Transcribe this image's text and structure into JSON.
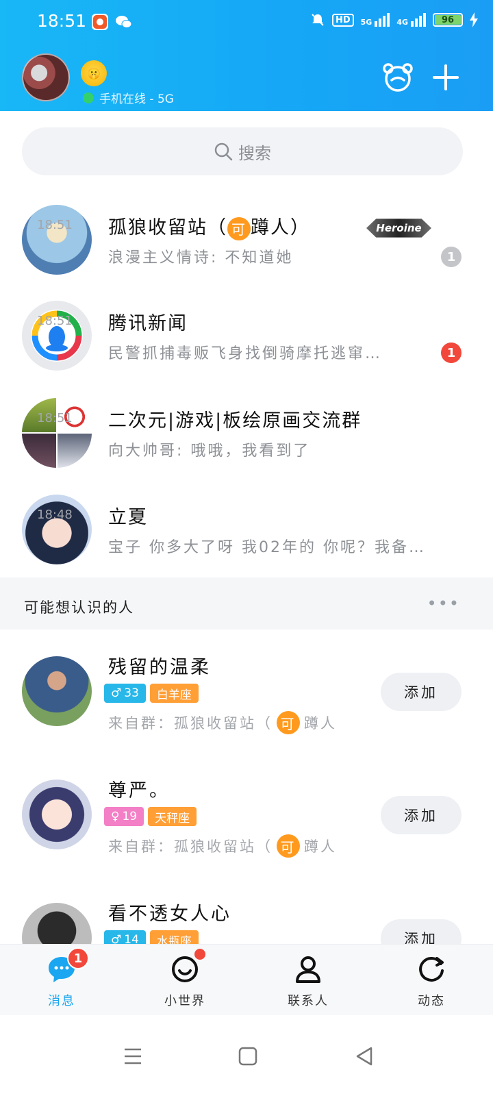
{
  "status_bar": {
    "time": "18:51",
    "network_left": "5G",
    "network_right": "4G",
    "hd": "HD",
    "battery": "96"
  },
  "profile": {
    "status_text": "手机在线 - 5G"
  },
  "search": {
    "placeholder": "搜索"
  },
  "chats": [
    {
      "name_prefix": "孤狼收留站（",
      "name_badge": "可",
      "name_suffix": "蹲人）",
      "tag": "Heroine",
      "message": "浪漫主义情诗: 不知道她",
      "time": "18:51",
      "unread": "1",
      "unread_style": "muted"
    },
    {
      "name": "腾讯新闻",
      "message": "民警抓捕毒贩飞身找倒骑摩托逃窜…",
      "time": "18:51",
      "unread": "1",
      "unread_style": "alert"
    },
    {
      "name": "二次元|游戏|板绘原画交流群",
      "message": "向大帅哥: 哦哦，我看到了",
      "time": "18:51"
    },
    {
      "name": "立夏",
      "message": "宝子 你多大了呀 我02年的 你呢？我备…",
      "time": "18:48"
    }
  ],
  "suggestions_section": {
    "title": "可能想认识的人",
    "more": "•••"
  },
  "suggestions": [
    {
      "name": "残留的温柔",
      "gender": "male",
      "age": "33",
      "zodiac": "白羊座",
      "from_prefix": "来自群：孤狼收留站（",
      "from_badge": "可",
      "from_suffix": "蹲人",
      "add_label": "添加"
    },
    {
      "name": "尊严。",
      "gender": "female",
      "age": "19",
      "zodiac": "天秤座",
      "from_prefix": "来自群：孤狼收留站（",
      "from_badge": "可",
      "from_suffix": "蹲人",
      "add_label": "添加"
    },
    {
      "name": "看不透女人心",
      "gender": "male",
      "age": "14",
      "zodiac": "水瓶座",
      "add_label": "添加"
    }
  ],
  "tabs": [
    {
      "label": "消息",
      "badge": "1",
      "active": true
    },
    {
      "label": "小世界"
    },
    {
      "label": "联系人"
    },
    {
      "label": "动态"
    }
  ],
  "colors": {
    "accent": "#1aa6f0",
    "header_gradient_start": "#18b7f6",
    "badge_red": "#f2473b",
    "zodiac_orange": "#ff9f36",
    "male_blue": "#27b7e9",
    "female_pink": "#f37fc6"
  }
}
